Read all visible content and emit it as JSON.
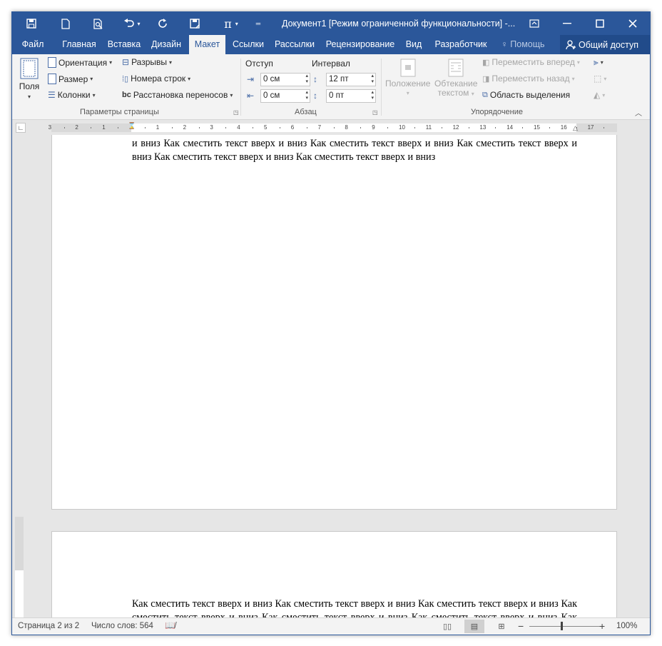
{
  "titlebar": {
    "title": "Документ1 [Режим ограниченной функциональности] -...",
    "qat": {
      "save_icon": "save-icon",
      "new_icon": "new-document-icon",
      "preview_icon": "print-preview-icon",
      "undo_icon": "undo-icon",
      "redo_icon": "redo-icon",
      "savefile_icon": "save-as-icon",
      "equation_symbol": "π"
    }
  },
  "tabs": [
    {
      "label": "Файл"
    },
    {
      "label": "Главная"
    },
    {
      "label": "Вставка"
    },
    {
      "label": "Дизайн"
    },
    {
      "label": "Макет"
    },
    {
      "label": "Ссылки"
    },
    {
      "label": "Рассылки"
    },
    {
      "label": "Рецензирование"
    },
    {
      "label": "Вид"
    },
    {
      "label": "Разработчик"
    },
    {
      "label": "Помощь"
    }
  ],
  "share_label": "Общий доступ",
  "ribbon": {
    "page_setup": {
      "margins_label": "Поля",
      "orientation_label": "Ориентация",
      "size_label": "Размер",
      "columns_label": "Колонки",
      "breaks_label": "Разрывы",
      "line_numbers_label": "Номера строк",
      "hyphenation_label": "Расстановка переносов",
      "group_label": "Параметры страницы"
    },
    "paragraph": {
      "indent_label": "Отступ",
      "spacing_label": "Интервал",
      "indent_left": "0 см",
      "indent_right": "0 см",
      "spacing_before": "12 пт",
      "spacing_after": "0 пт",
      "group_label": "Абзац"
    },
    "arrange": {
      "position_label": "Положение",
      "wrap_label_1": "Обтекание",
      "wrap_label_2": "текстом",
      "bring_forward_label": "Переместить вперед",
      "send_backward_label": "Переместить назад",
      "selection_pane_label": "Область выделения",
      "group_label": "Упорядочение"
    }
  },
  "ruler": {
    "labels": [
      "3",
      "2",
      "1",
      "1",
      "2",
      "3",
      "4",
      "5",
      "6",
      "7",
      "8",
      "9",
      "10",
      "11",
      "12",
      "13",
      "14",
      "15",
      "16",
      "17"
    ]
  },
  "document": {
    "page1_text": "и вниз Как сместить текст вверх и вниз Как сместить текст вверх и вниз Как сместить текст вверх и вниз Как сместить текст вверх и вниз Как сместить текст вверх и вниз",
    "page2_text": "Как сместить текст вверх и вниз Как сместить текст вверх и вниз Как сместить текст вверх и вниз Как сместить текст вверх и вниз Как сместить текст вверх и вниз Как сместить текст вверх и вниз Как сместить текст вверх и вниз Как сместить текст вверх и вниз Как"
  },
  "status": {
    "page": "Страница 2 из 2",
    "words": "Число слов: 564",
    "zoom": "100%",
    "zoom_level_percent": 100
  }
}
